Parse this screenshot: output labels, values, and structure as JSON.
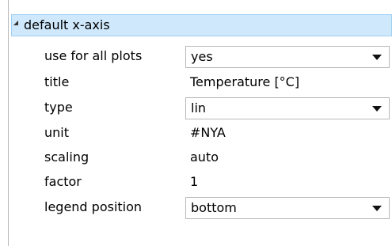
{
  "group": {
    "label": "default x-axis",
    "rows": [
      {
        "label": "use for all plots",
        "value": "yes"
      },
      {
        "label": "title",
        "value": "Temperature [°C]"
      },
      {
        "label": "type",
        "value": "lin"
      },
      {
        "label": "unit",
        "value": "#NYA"
      },
      {
        "label": "scaling",
        "value": "auto"
      },
      {
        "label": "factor",
        "value": "1"
      },
      {
        "label": "legend position",
        "value": "bottom"
      }
    ]
  },
  "icons": {
    "expander": "triangle-expanded-icon",
    "dropdown": "chevron-down-icon"
  },
  "colors": {
    "header_bg": "#cfe8fc",
    "header_border": "#9ccff2"
  }
}
